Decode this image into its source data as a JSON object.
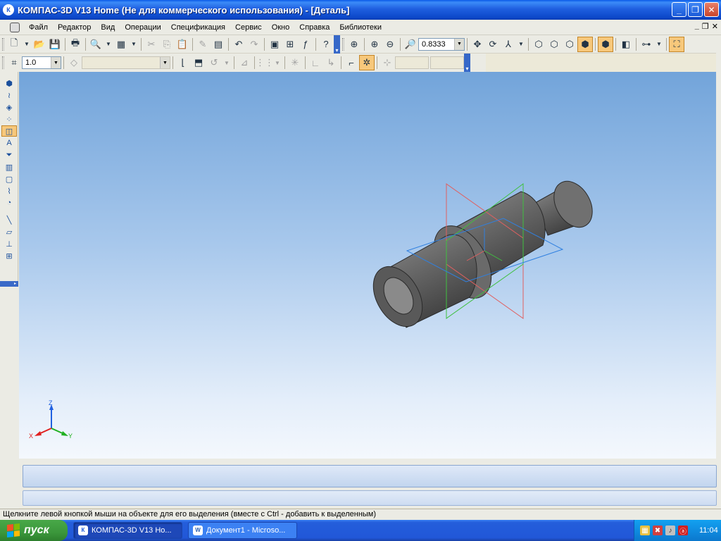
{
  "window": {
    "title": "КОМПАС-3D V13 Home (Не для коммерческого использования) - [Деталь]",
    "app_icon": "К"
  },
  "menu": {
    "items": [
      "Файл",
      "Редактор",
      "Вид",
      "Операции",
      "Спецификация",
      "Сервис",
      "Окно",
      "Справка",
      "Библиотеки"
    ]
  },
  "toolbar": {
    "zoom_value": "0.8333",
    "step_value": "1.0",
    "layer_combo": "",
    "field_a": "",
    "field_b": ""
  },
  "viewport": {
    "background": "#8EB6E3",
    "axes": {
      "x_label": "X",
      "y_label": "Y",
      "z_label": "Z"
    },
    "colors": {
      "x_axis": "#e02020",
      "y_axis": "#20b020",
      "z_axis": "#2060e0",
      "part": "#6e6e6e"
    }
  },
  "status_bar": {
    "text": "Щелкните левой кнопкой мыши на объекте для его выделения (вместе с Ctrl - добавить к выделенным)"
  },
  "taskbar": {
    "start_label": "пуск",
    "tasks": [
      {
        "label": "КОМПАС-3D V13 Ho...",
        "icon": "kompas-icon",
        "active": true
      },
      {
        "label": "Документ1 - Microso...",
        "icon": "word-icon",
        "active": false
      }
    ],
    "clock": "11:04"
  }
}
